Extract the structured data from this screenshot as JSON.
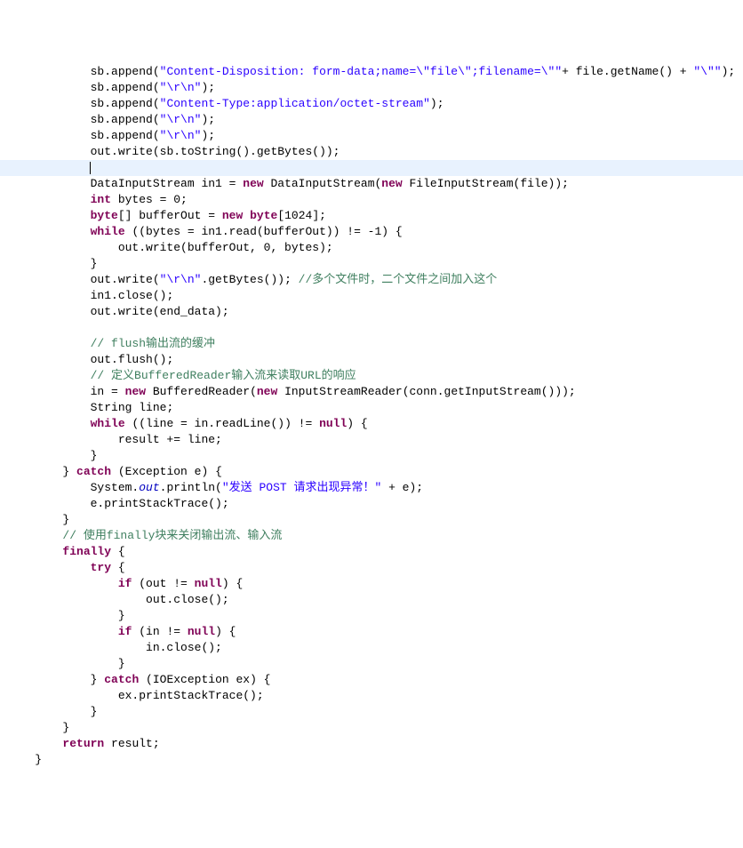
{
  "code": {
    "editor": "java-source",
    "language": "Java",
    "highlighted_line_index": 6,
    "lines": [
      {
        "indent": 3,
        "tokens": [
          {
            "t": "plain",
            "v": "sb.append("
          },
          {
            "t": "str",
            "v": "\"Content-Disposition: form-data;name=\\\"file\\\";filename=\\\"\""
          },
          {
            "t": "plain",
            "v": "+ file.getName() + "
          },
          {
            "t": "str",
            "v": "\"\\\"\""
          },
          {
            "t": "plain",
            "v": ");"
          }
        ]
      },
      {
        "indent": 3,
        "tokens": [
          {
            "t": "plain",
            "v": "sb.append("
          },
          {
            "t": "str",
            "v": "\"\\r\\n\""
          },
          {
            "t": "plain",
            "v": ");"
          }
        ]
      },
      {
        "indent": 3,
        "tokens": [
          {
            "t": "plain",
            "v": "sb.append("
          },
          {
            "t": "str",
            "v": "\"Content-Type:application/octet-stream\""
          },
          {
            "t": "plain",
            "v": ");"
          }
        ]
      },
      {
        "indent": 3,
        "tokens": [
          {
            "t": "plain",
            "v": "sb.append("
          },
          {
            "t": "str",
            "v": "\"\\r\\n\""
          },
          {
            "t": "plain",
            "v": ");"
          }
        ]
      },
      {
        "indent": 3,
        "tokens": [
          {
            "t": "plain",
            "v": "sb.append("
          },
          {
            "t": "str",
            "v": "\"\\r\\n\""
          },
          {
            "t": "plain",
            "v": ");"
          }
        ]
      },
      {
        "indent": 3,
        "tokens": [
          {
            "t": "plain",
            "v": "out.write(sb.toString().getBytes());"
          }
        ]
      },
      {
        "indent": 3,
        "tokens": [],
        "caret": true
      },
      {
        "indent": 3,
        "tokens": [
          {
            "t": "plain",
            "v": "DataInputStream in1 = "
          },
          {
            "t": "kw",
            "v": "new"
          },
          {
            "t": "plain",
            "v": " DataInputStream("
          },
          {
            "t": "kw",
            "v": "new"
          },
          {
            "t": "plain",
            "v": " FileInputStream(file));"
          }
        ]
      },
      {
        "indent": 3,
        "tokens": [
          {
            "t": "kw",
            "v": "int"
          },
          {
            "t": "plain",
            "v": " bytes = 0;"
          }
        ]
      },
      {
        "indent": 3,
        "tokens": [
          {
            "t": "kw",
            "v": "byte"
          },
          {
            "t": "plain",
            "v": "[] bufferOut = "
          },
          {
            "t": "kw",
            "v": "new"
          },
          {
            "t": "plain",
            "v": " "
          },
          {
            "t": "kw",
            "v": "byte"
          },
          {
            "t": "plain",
            "v": "[1024];"
          }
        ]
      },
      {
        "indent": 3,
        "tokens": [
          {
            "t": "kw",
            "v": "while"
          },
          {
            "t": "plain",
            "v": " ((bytes = in1.read(bufferOut)) != -1) {"
          }
        ]
      },
      {
        "indent": 4,
        "tokens": [
          {
            "t": "plain",
            "v": "out.write(bufferOut, 0, bytes);"
          }
        ]
      },
      {
        "indent": 3,
        "tokens": [
          {
            "t": "plain",
            "v": "}"
          }
        ]
      },
      {
        "indent": 3,
        "tokens": [
          {
            "t": "plain",
            "v": "out.write("
          },
          {
            "t": "str",
            "v": "\"\\r\\n\""
          },
          {
            "t": "plain",
            "v": ".getBytes()); "
          },
          {
            "t": "com",
            "v": "//多个文件时，二个文件之间加入这个"
          }
        ]
      },
      {
        "indent": 3,
        "tokens": [
          {
            "t": "plain",
            "v": "in1.close();"
          }
        ]
      },
      {
        "indent": 3,
        "tokens": [
          {
            "t": "plain",
            "v": "out.write(end_data);"
          }
        ]
      },
      {
        "indent": 3,
        "tokens": []
      },
      {
        "indent": 3,
        "tokens": [
          {
            "t": "com",
            "v": "// flush输出流的缓冲"
          }
        ]
      },
      {
        "indent": 3,
        "tokens": [
          {
            "t": "plain",
            "v": "out.flush();"
          }
        ]
      },
      {
        "indent": 3,
        "tokens": [
          {
            "t": "com",
            "v": "// 定义BufferedReader输入流来读取URL的响应"
          }
        ]
      },
      {
        "indent": 3,
        "tokens": [
          {
            "t": "plain",
            "v": "in = "
          },
          {
            "t": "kw",
            "v": "new"
          },
          {
            "t": "plain",
            "v": " BufferedReader("
          },
          {
            "t": "kw",
            "v": "new"
          },
          {
            "t": "plain",
            "v": " InputStreamReader(conn.getInputStream()));"
          }
        ]
      },
      {
        "indent": 3,
        "tokens": [
          {
            "t": "plain",
            "v": "String line;"
          }
        ]
      },
      {
        "indent": 3,
        "tokens": [
          {
            "t": "kw",
            "v": "while"
          },
          {
            "t": "plain",
            "v": " ((line = in.readLine()) != "
          },
          {
            "t": "kw",
            "v": "null"
          },
          {
            "t": "plain",
            "v": ") {"
          }
        ]
      },
      {
        "indent": 4,
        "tokens": [
          {
            "t": "plain",
            "v": "result += line;"
          }
        ]
      },
      {
        "indent": 3,
        "tokens": [
          {
            "t": "plain",
            "v": "}"
          }
        ]
      },
      {
        "indent": 2,
        "tokens": [
          {
            "t": "plain",
            "v": "} "
          },
          {
            "t": "kw",
            "v": "catch"
          },
          {
            "t": "plain",
            "v": " (Exception e) {"
          }
        ]
      },
      {
        "indent": 3,
        "tokens": [
          {
            "t": "plain",
            "v": "System."
          },
          {
            "t": "fld",
            "v": "out"
          },
          {
            "t": "plain",
            "v": ".println("
          },
          {
            "t": "str",
            "v": "\"发送 POST 请求出现异常！\""
          },
          {
            "t": "plain",
            "v": " + e);"
          }
        ]
      },
      {
        "indent": 3,
        "tokens": [
          {
            "t": "plain",
            "v": "e.printStackTrace();"
          }
        ]
      },
      {
        "indent": 2,
        "tokens": [
          {
            "t": "plain",
            "v": "}"
          }
        ]
      },
      {
        "indent": 2,
        "tokens": [
          {
            "t": "com",
            "v": "// 使用finally块来关闭输出流、输入流"
          }
        ]
      },
      {
        "indent": 2,
        "tokens": [
          {
            "t": "kw",
            "v": "finally"
          },
          {
            "t": "plain",
            "v": " {"
          }
        ]
      },
      {
        "indent": 3,
        "tokens": [
          {
            "t": "kw",
            "v": "try"
          },
          {
            "t": "plain",
            "v": " {"
          }
        ]
      },
      {
        "indent": 4,
        "tokens": [
          {
            "t": "kw",
            "v": "if"
          },
          {
            "t": "plain",
            "v": " (out != "
          },
          {
            "t": "kw",
            "v": "null"
          },
          {
            "t": "plain",
            "v": ") {"
          }
        ]
      },
      {
        "indent": 5,
        "tokens": [
          {
            "t": "plain",
            "v": "out.close();"
          }
        ]
      },
      {
        "indent": 4,
        "tokens": [
          {
            "t": "plain",
            "v": "}"
          }
        ]
      },
      {
        "indent": 4,
        "tokens": [
          {
            "t": "kw",
            "v": "if"
          },
          {
            "t": "plain",
            "v": " (in != "
          },
          {
            "t": "kw",
            "v": "null"
          },
          {
            "t": "plain",
            "v": ") {"
          }
        ]
      },
      {
        "indent": 5,
        "tokens": [
          {
            "t": "plain",
            "v": "in.close();"
          }
        ]
      },
      {
        "indent": 4,
        "tokens": [
          {
            "t": "plain",
            "v": "}"
          }
        ]
      },
      {
        "indent": 3,
        "tokens": [
          {
            "t": "plain",
            "v": "} "
          },
          {
            "t": "kw",
            "v": "catch"
          },
          {
            "t": "plain",
            "v": " (IOException ex) {"
          }
        ]
      },
      {
        "indent": 4,
        "tokens": [
          {
            "t": "plain",
            "v": "ex.printStackTrace();"
          }
        ]
      },
      {
        "indent": 3,
        "tokens": [
          {
            "t": "plain",
            "v": "}"
          }
        ]
      },
      {
        "indent": 2,
        "tokens": [
          {
            "t": "plain",
            "v": "}"
          }
        ]
      },
      {
        "indent": 2,
        "tokens": [
          {
            "t": "kw",
            "v": "return"
          },
          {
            "t": "plain",
            "v": " result;"
          }
        ]
      },
      {
        "indent": 1,
        "tokens": [
          {
            "t": "plain",
            "v": "}"
          }
        ]
      }
    ]
  },
  "colors": {
    "keyword": "#7f0055",
    "string": "#2a00ff",
    "comment": "#3f7f5f",
    "field": "#0000c0",
    "highlight_bg": "#e8f2fe"
  }
}
